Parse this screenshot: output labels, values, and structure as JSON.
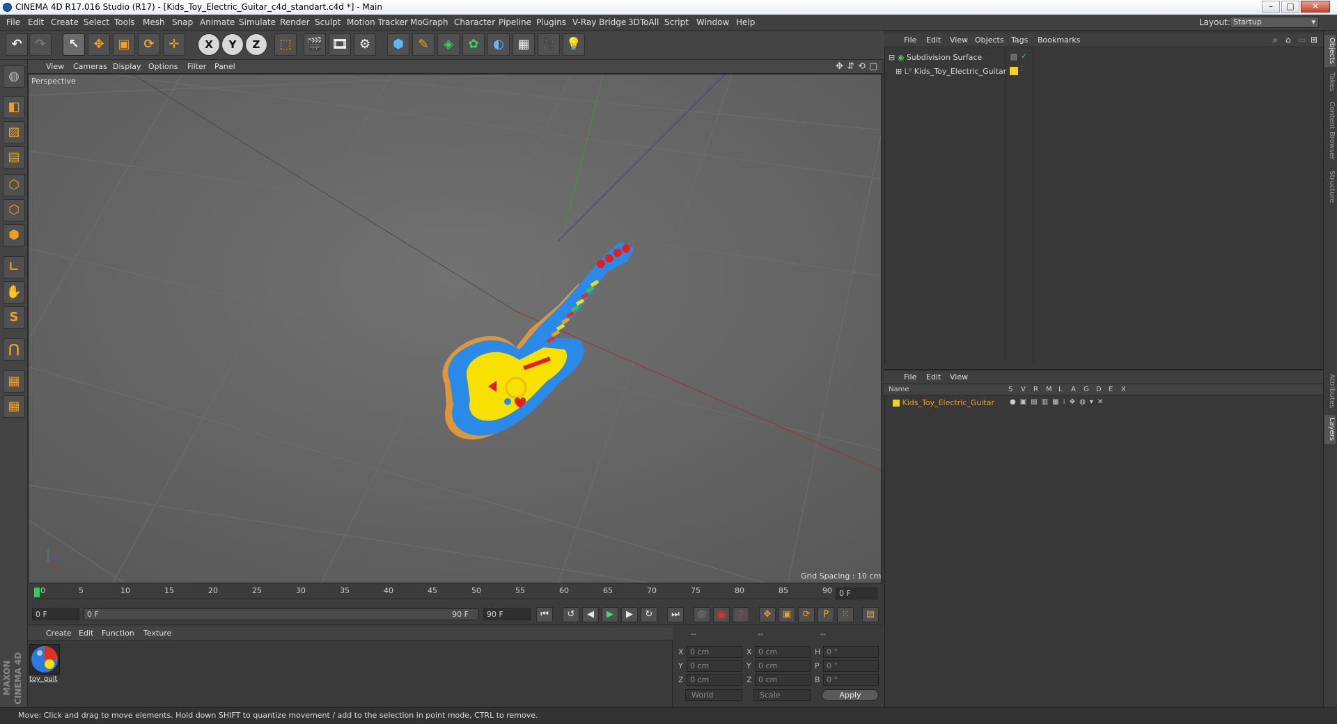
{
  "window": {
    "title": "CINEMA 4D R17.016 Studio (R17) - [Kids_Toy_Electric_Guitar_c4d_standart.c4d *] - Main",
    "min": "–",
    "max": "□",
    "close": "✕"
  },
  "menu": [
    "File",
    "Edit",
    "Create",
    "Select",
    "Tools",
    "Mesh",
    "Snap",
    "Animate",
    "Simulate",
    "Render",
    "Sculpt",
    "Motion Tracker",
    "MoGraph",
    "Character",
    "Pipeline",
    "Plugins",
    "V-Ray Bridge",
    "3DToAll",
    "Script",
    "Window",
    "Help"
  ],
  "layout": {
    "label": "Layout:",
    "value": "Startup"
  },
  "viewport": {
    "menu": [
      "View",
      "Cameras",
      "Display",
      "Options",
      "Filter",
      "Panel"
    ],
    "label": "Perspective",
    "grid_spacing": "Grid Spacing : 10 cm"
  },
  "timeline": {
    "ticks": [
      "0",
      "5",
      "10",
      "15",
      "20",
      "25",
      "30",
      "35",
      "40",
      "45",
      "50",
      "55",
      "60",
      "65",
      "70",
      "75",
      "80",
      "85",
      "90"
    ],
    "current": "0 F",
    "start": "0 F",
    "range_start": "0 F",
    "range_end": "90 F",
    "end": "90 F"
  },
  "material": {
    "menu": [
      "Create",
      "Edit",
      "Function",
      "Texture"
    ],
    "name": "toy_guit"
  },
  "coords": {
    "header": [
      "--",
      "--",
      "--"
    ],
    "rows": [
      {
        "a": "X",
        "av": "0 cm",
        "b": "X",
        "bv": "0 cm",
        "c": "H",
        "cv": "0 °"
      },
      {
        "a": "Y",
        "av": "0 cm",
        "b": "Y",
        "bv": "0 cm",
        "c": "P",
        "cv": "0 °"
      },
      {
        "a": "Z",
        "av": "0 cm",
        "b": "Z",
        "bv": "0 cm",
        "c": "B",
        "cv": "0 °"
      }
    ],
    "space": "World",
    "mode": "Scale",
    "apply": "Apply"
  },
  "objects": {
    "menu": [
      "File",
      "Edit",
      "View",
      "Objects",
      "Tags",
      "Bookmarks"
    ],
    "items": [
      "Subdivision Surface",
      "Kids_Toy_Electric_Guitar"
    ]
  },
  "layers": {
    "menu": [
      "File",
      "Edit",
      "View"
    ],
    "header_name": "Name",
    "header_flags": [
      "S",
      "V",
      "R",
      "M",
      "L",
      "A",
      "G",
      "D",
      "E",
      "X"
    ],
    "item": "Kids_Toy_Electric_Guitar"
  },
  "side_tabs": [
    "Objects",
    "Takes",
    "Content Browser",
    "Structure",
    "Attributes",
    "Layers"
  ],
  "maxon": "MAXON CINEMA 4D",
  "status": "Move: Click and drag to move elements. Hold down SHIFT to quantize movement / add to the selection in point mode, CTRL to remove.",
  "colors": {
    "accent": "#f0a020",
    "layer": "#f0d020",
    "viewport_bg": "#636363"
  }
}
